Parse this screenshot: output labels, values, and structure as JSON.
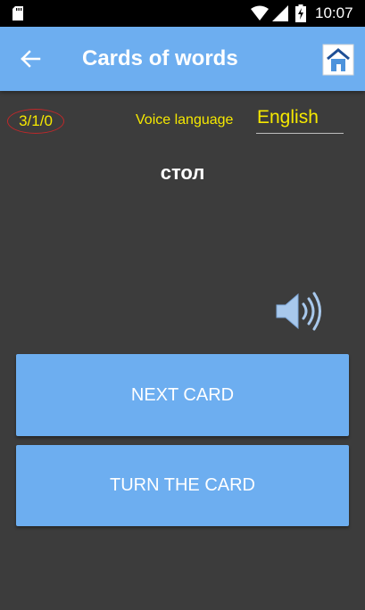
{
  "status_bar": {
    "time": "10:07",
    "icons": [
      "sd-card-icon",
      "wifi-icon",
      "cell-signal-icon",
      "battery-charging-icon"
    ]
  },
  "app_bar": {
    "back_icon": "arrow-left-icon",
    "title": "Cards of words",
    "home_icon": "home-icon"
  },
  "stats": {
    "counter": "3/1/0"
  },
  "voice": {
    "label": "Voice language",
    "selected": "English"
  },
  "card": {
    "word": "стол",
    "speaker_icon": "speaker-icon"
  },
  "buttons": {
    "next": "NEXT CARD",
    "turn": "TURN THE CARD"
  },
  "colors": {
    "app_bar": "#6daef0",
    "background": "#3c3c3c",
    "accent_text": "#f5e800",
    "counter_outline": "#c0282a",
    "button": "#6daef0"
  }
}
